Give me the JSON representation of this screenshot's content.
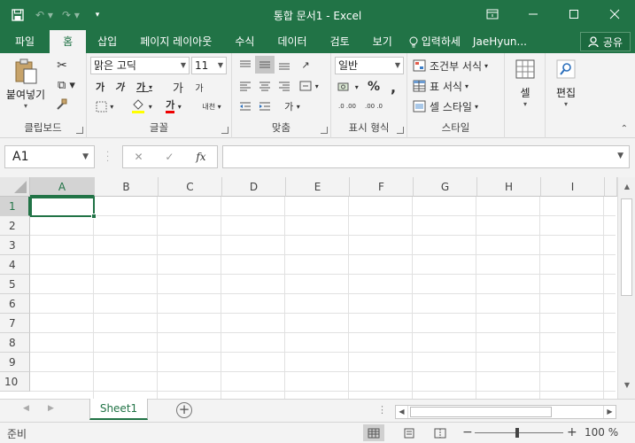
{
  "window": {
    "title": "통합 문서1 - Excel"
  },
  "tabs": [
    {
      "label": "파일"
    },
    {
      "label": "홈"
    },
    {
      "label": "삽입"
    },
    {
      "label": "페이지 레이아웃"
    },
    {
      "label": "수식"
    },
    {
      "label": "데이터"
    },
    {
      "label": "검토"
    },
    {
      "label": "보기"
    }
  ],
  "tell_me": "입력하세",
  "user_name": "JaeHyun...",
  "share_label": "공유",
  "ribbon": {
    "clipboard": {
      "paste_label": "붙여넣기",
      "group_label": "클립보드"
    },
    "font": {
      "font_name": "맑은 고딕",
      "font_size": "11",
      "bold": "가",
      "italic": "가",
      "underline": "가",
      "grow": "가",
      "shrink": "가",
      "font_color_glyph": "가",
      "phonetic": "내천",
      "group_label": "글꼴"
    },
    "alignment": {
      "wrap": "가",
      "group_label": "맞춤"
    },
    "number": {
      "format": "일반",
      "percent": "%",
      "comma": ",",
      "inc_decimal": ".0 .00",
      "dec_decimal": ".00 .0",
      "group_label": "표시 형식"
    },
    "styles": {
      "conditional": "조건부 서식",
      "table": "표 서식",
      "cell_style": "셀 스타일",
      "group_label": "스타일"
    },
    "cells": {
      "label": "셀"
    },
    "editing": {
      "label": "편집"
    }
  },
  "formula_bar": {
    "name_box": "A1",
    "fx": "fx",
    "value": ""
  },
  "grid": {
    "columns": [
      "A",
      "B",
      "C",
      "D",
      "E",
      "F",
      "G",
      "H",
      "I"
    ],
    "rows": [
      "1",
      "2",
      "3",
      "4",
      "5",
      "6",
      "7",
      "8",
      "9",
      "10"
    ],
    "active_cell": "A1"
  },
  "sheets": [
    {
      "name": "Sheet1"
    }
  ],
  "status": {
    "text": "준비",
    "zoom": "100 %",
    "minus": "−",
    "plus": "+"
  },
  "colors": {
    "brand": "#217346"
  }
}
